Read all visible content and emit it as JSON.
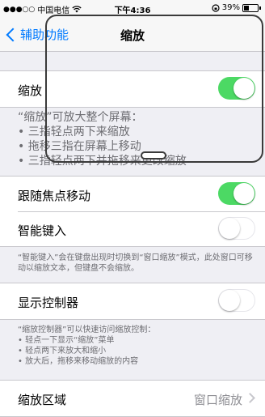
{
  "status_bar": {
    "signal_dots": "●●●○○",
    "carrier": "中国电信",
    "wifi_icon": "wifi-icon",
    "time": "下午4:36",
    "battery_percent": "39%",
    "battery_level": 0.39
  },
  "nav": {
    "back_label": "辅助功能",
    "title": "缩放"
  },
  "zoom_row": {
    "label": "缩放",
    "toggle_on": true
  },
  "zoom_footer": {
    "title": "“缩放”可放大整个屏幕：",
    "items": [
      "• 三指轻点两下来缩放",
      "• 拖移三指在屏幕上移动",
      "• 三指轻点两下并拖移来更改缩放"
    ]
  },
  "follow_focus_row": {
    "label": "跟随焦点移动",
    "toggle_on": true
  },
  "smart_typing_row": {
    "label": "智能键入",
    "toggle_on": false
  },
  "smart_typing_footer": "“智能键入”会在键盘出现时切换到“窗口缩放”模式，此处窗口可移动以缩放文本，但键盘不会缩放。",
  "controller_row": {
    "label": "显示控制器",
    "toggle_on": false
  },
  "controller_footer": {
    "title": "“缩放控制器”可以快速访问缩放控制：",
    "items": [
      "• 轻点一下显示“缩放”菜单",
      "• 轻点两下来放大和缩小",
      "• 放大后，拖移来移动缩放的内容"
    ]
  },
  "zoom_region_row": {
    "label": "缩放区域",
    "value": "窗口缩放"
  },
  "colors": {
    "accent": "#007aff",
    "toggle_on": "#4cd964",
    "background": "#efeff4"
  }
}
